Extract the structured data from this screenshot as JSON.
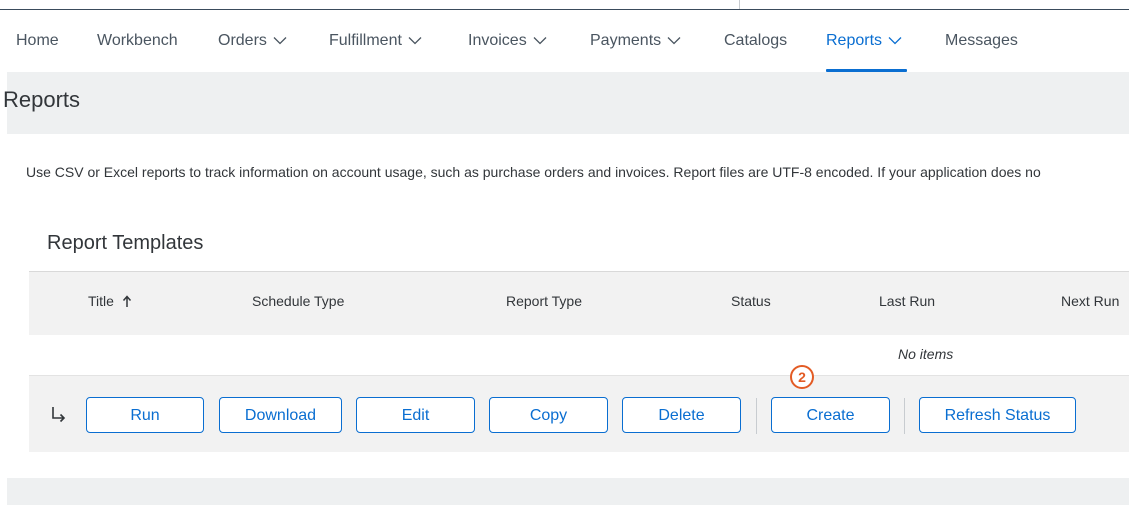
{
  "nav": {
    "items": [
      {
        "label": "Home",
        "has_dropdown": false
      },
      {
        "label": "Workbench",
        "has_dropdown": false
      },
      {
        "label": "Orders",
        "has_dropdown": true
      },
      {
        "label": "Fulfillment",
        "has_dropdown": true
      },
      {
        "label": "Invoices",
        "has_dropdown": true
      },
      {
        "label": "Payments",
        "has_dropdown": true
      },
      {
        "label": "Catalogs",
        "has_dropdown": false
      },
      {
        "label": "Reports",
        "has_dropdown": true,
        "active": true
      },
      {
        "label": "Messages",
        "has_dropdown": false
      }
    ]
  },
  "page": {
    "title": "Reports",
    "description": "Use CSV or Excel reports to track information on account usage, such as purchase orders and invoices. Report files are UTF-8 encoded. If your application does no"
  },
  "templates": {
    "title": "Report Templates",
    "columns": [
      "Title",
      "Schedule Type",
      "Report Type",
      "Status",
      "Last Run",
      "Next Run"
    ],
    "sorted_column": "Title",
    "empty_text": "No items"
  },
  "actions": {
    "run": "Run",
    "download": "Download",
    "edit": "Edit",
    "copy": "Copy",
    "delete": "Delete",
    "create": "Create",
    "refresh": "Refresh Status"
  },
  "annotation": {
    "step": "2"
  },
  "colors": {
    "accent": "#0a6ed1",
    "badge": "#e35b24",
    "header_bg": "#eef0f1"
  },
  "icons": {
    "sort": "arrow-up-icon",
    "dropdown": "chevron-down-icon",
    "row_action": "return-arrow-icon"
  }
}
